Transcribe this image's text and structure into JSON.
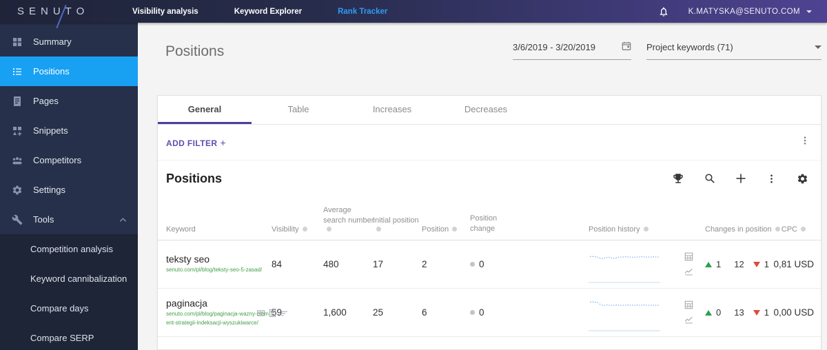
{
  "topbar": {
    "logo_text": "SENUTO",
    "nav": [
      "Visibility analysis",
      "Keyword Explorer",
      "Rank Tracker"
    ],
    "user_email": "K.MATYSKA@SENUTO.COM"
  },
  "sidebar": {
    "items": [
      "Summary",
      "Positions",
      "Pages",
      "Snippets",
      "Competitors",
      "Settings",
      "Tools"
    ],
    "tools_subitems": [
      "Competition analysis",
      "Keyword cannibalization",
      "Compare days",
      "Compare SERP"
    ]
  },
  "header": {
    "page_title": "Positions",
    "date_range": "3/6/2019 - 3/20/2019",
    "project_select": "Project keywords (71)"
  },
  "tabs": [
    "General",
    "Table",
    "Increases",
    "Decreases"
  ],
  "filter": {
    "add_filter": "ADD FILTER",
    "plus": "+"
  },
  "card": {
    "title": "Positions",
    "columns": {
      "keyword": "Keyword",
      "visibility": "Visibility",
      "avg_line1": "Average",
      "avg_line2": "search number",
      "initial": "Initial position",
      "position": "Position",
      "pc_line1": "Position",
      "pc_line2": "change",
      "history": "Position history",
      "changes": "Changes in position",
      "cpc": "CPC"
    },
    "rows": [
      {
        "keyword": "teksty seo",
        "url": "senuto.com/pl/blog/teksty-seo-5-zasad/",
        "visibility": "84",
        "avg_search": "480",
        "initial_position": "17",
        "position": "2",
        "position_change": "0",
        "changes_up": "1",
        "changes_same": "12",
        "changes_down": "1",
        "cpc": "0,81 USD",
        "spark": [
          0.28,
          0.28,
          0.29,
          0.31,
          0.34,
          0.36,
          0.34,
          0.32,
          0.31,
          0.33,
          0.35,
          0.33,
          0.31,
          0.3,
          0.3,
          0.29,
          0.3,
          0.3,
          0.31,
          0.3,
          0.3,
          0.3,
          0.29,
          0.3,
          0.3,
          0.3,
          0.3,
          0.29,
          0.3,
          0.3
        ]
      },
      {
        "keyword": "paginacja",
        "url": "senuto.com/pl/blog/paginacja-wazny-element-strategii-indeksacji-wyszukiwarce/",
        "visibility": "59",
        "avg_search": "1,600",
        "initial_position": "25",
        "position": "6",
        "position_change": "0",
        "changes_up": "0",
        "changes_same": "13",
        "changes_down": "1",
        "cpc": "0,00 USD",
        "spark": [
          0.18,
          0.18,
          0.19,
          0.2,
          0.26,
          0.3,
          0.3,
          0.29,
          0.3,
          0.3,
          0.3,
          0.29,
          0.3,
          0.3,
          0.3,
          0.3,
          0.29,
          0.3,
          0.3,
          0.3,
          0.29,
          0.3,
          0.3,
          0.29,
          0.3,
          0.3,
          0.3,
          0.3,
          0.3,
          0.3
        ]
      }
    ]
  },
  "colors": {
    "topbar_gradient_start": "#1f2439",
    "topbar_gradient_end": "#4e4392",
    "sidebar_bg": "#26304a",
    "active_item_blue": "#18a0f2",
    "rank_tracker_blue": "#2f9cf4",
    "tab_underline_purple": "#4b3d9c",
    "add_filter_purple": "#5b4fae",
    "url_green": "#43a047",
    "up_green": "#2e9e4f",
    "down_red": "#e04b3a",
    "spark_blue": "#7fb3e8"
  }
}
